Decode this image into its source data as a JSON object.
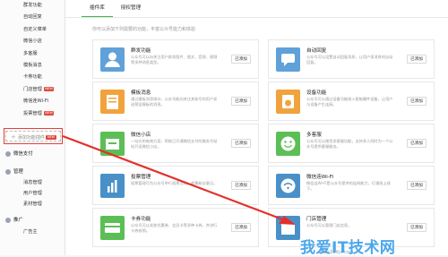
{
  "sidebar": {
    "top_items": [
      {
        "label": "群发功能"
      },
      {
        "label": "自动回复"
      },
      {
        "label": "自定义菜单"
      },
      {
        "label": "微信小店"
      },
      {
        "label": "多客服"
      },
      {
        "label": "模板消息"
      },
      {
        "label": "卡券功能"
      },
      {
        "label": "门店管理",
        "badge": "NEW"
      },
      {
        "label": "微信连Wi-Fi"
      },
      {
        "label": "投票管理",
        "badge": "NEW"
      }
    ],
    "add_plugin": "添加功能插件",
    "add_badge": "NEW",
    "wechat_pay": "微信支付",
    "management": "管理",
    "management_items": [
      "消息管理",
      "用户管理",
      "素材管理"
    ],
    "promotion": "推广",
    "promotion_items": [
      "广告主"
    ]
  },
  "tabs": [
    {
      "label": "插件库",
      "active": true
    },
    {
      "label": "授权管理",
      "active": false
    }
  ],
  "description": "你可以添加下列需要的功能，丰富公众号能力和体验",
  "plugins": [
    {
      "title": "群发功能",
      "text": "公众号可以向关注用户群发图片、图文、音频、视频等多种消息类型。",
      "action": "已添加",
      "icon": "user-icon",
      "color": "#5fa1d8"
    },
    {
      "title": "自动回复",
      "text": "公众号可以设置自动回复消息，让用户发消息时自动回复。",
      "action": "已添加",
      "icon": "chat-icon",
      "color": "#5fa1d8"
    },
    {
      "title": "模板消息",
      "text": "通过模板消息接口，公众号能向关注其账号的用户发送预设模板的消息。",
      "action": "已添加",
      "icon": "document-icon",
      "color": "#f0a33c"
    },
    {
      "title": "设备功能",
      "text": "公众号可以通过设备功能接入智能硬件设备，让用户与设备产生连接。",
      "action": "已添加",
      "icon": "device-icon",
      "color": "#f0a33c"
    },
    {
      "title": "微信小店",
      "text": "一站式的电商方案，帮助已开通微信支付的服务号轻松开设微信小店。",
      "action": "已添加",
      "icon": "shop-icon",
      "color": "#5bbf56"
    },
    {
      "title": "多客服",
      "text": "公众号可以使用多客服功能，支持多人同时为一个公众号提供客服服务。",
      "action": "已添加",
      "icon": "smile-icon",
      "color": "#5bbf56"
    },
    {
      "title": "投票管理",
      "text": "投票管理可为公众号举行投票活动，收集粉丝意见。",
      "action": "已添加",
      "icon": "bar-chart-icon",
      "color": "#4a90c8"
    },
    {
      "title": "微信连Wi-Fi",
      "text": "微信连Wi-Fi是公众号提供的连网能力，打通线上线下。",
      "action": "已添加",
      "icon": "wifi-icon",
      "color": "#4a90c8"
    },
    {
      "title": "卡券功能",
      "text": "公众号可以发放优惠券、会员卡等多种卡券，并进行卡券核销。",
      "action": "已添加",
      "icon": "card-icon",
      "color": "#5bbf56"
    },
    {
      "title": "门店管理",
      "text": "公众号可以管理门店信息。",
      "action": "已添加",
      "icon": "store-icon",
      "color": "#4a90c8"
    }
  ],
  "watermark": "我爱IT技术网",
  "watermark_url": "www.52itjs.com"
}
